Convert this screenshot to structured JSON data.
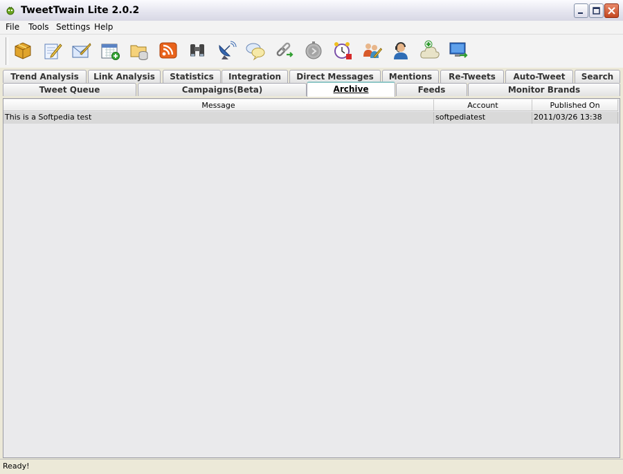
{
  "window": {
    "title": "TweetTwain Lite 2.0.2",
    "controls": [
      "minimize-icon",
      "maximize-icon",
      "close-icon"
    ]
  },
  "menu": [
    "File",
    "Tools",
    "Settings",
    "Help"
  ],
  "toolbar": {
    "icons": [
      "package-icon",
      "compose-icon",
      "email-icon",
      "calendar-add-icon",
      "folder-database-icon",
      "rss-icon",
      "binoculars-icon",
      "satellite-dish-icon",
      "chat-bubbles-icon",
      "link-icon",
      "timer-icon",
      "alarm-clock-icon",
      "users-edit-icon",
      "support-agent-icon",
      "cloud-add-icon",
      "monitor-export-icon"
    ]
  },
  "tabs": {
    "row1": [
      "Trend Analysis",
      "Link Analysis",
      "Statistics",
      "Integration",
      "Direct Messages",
      "Mentions",
      "Re-Tweets",
      "Auto-Tweet",
      "Search"
    ],
    "row2": [
      "Tweet Queue",
      "Campaigns(Beta)",
      "Archive",
      "Feeds",
      "Monitor Brands"
    ],
    "active": "Archive"
  },
  "grid": {
    "columns": [
      "Message",
      "Account",
      "Published On"
    ],
    "rows": [
      {
        "message": "This is a Softpedia test",
        "account": "softpediatest",
        "published_on": "2011/03/26 13:38"
      }
    ]
  },
  "status": "Ready!",
  "colors": {
    "title_bar": "#e4e4ee",
    "close_button": "#c3461f",
    "active_tab_accent": "#8fc7c7",
    "selected_row": "#d9d9d9"
  }
}
